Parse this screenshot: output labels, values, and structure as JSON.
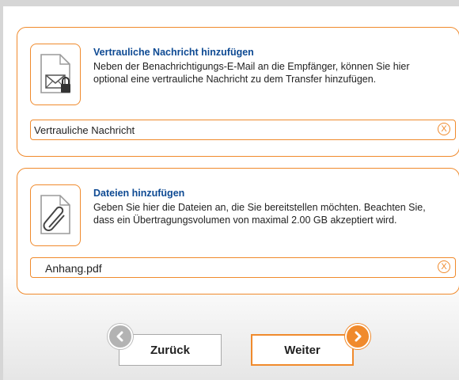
{
  "confidential": {
    "title": "Vertrauliche Nachricht hinzufügen",
    "description": "Neben der Benachrichtigungs-E-Mail an die Empfänger, können Sie hier optional eine vertrauliche Nachricht zu dem Transfer hinzufügen.",
    "input_value": "Vertrauliche Nachricht",
    "icon": "envelope-lock-icon"
  },
  "files": {
    "title": "Dateien hinzufügen",
    "description": "Geben Sie hier die Dateien an, die Sie bereitstellen möchten. Beachten Sie, dass ein Übertragungsvolumen von maximal 2.00 GB akzeptiert wird.",
    "input_value": "Anhang.pdf",
    "icon": "paperclip-icon"
  },
  "clear_glyph": "X",
  "nav": {
    "back_label": "Zurück",
    "next_label": "Weiter"
  },
  "colors": {
    "accent": "#f08a2c",
    "title": "#0e4a93",
    "background": "#d6d6d6"
  }
}
